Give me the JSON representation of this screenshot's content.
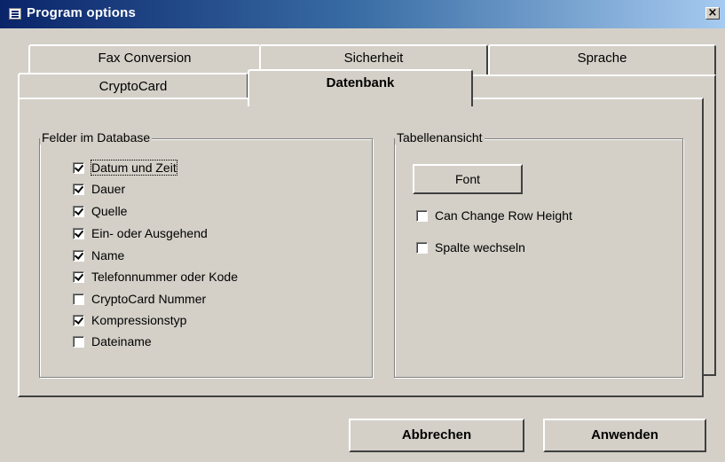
{
  "window": {
    "title": "Program options",
    "close_label": "×",
    "app_icon": "app-icon"
  },
  "tabs": {
    "back_row": [
      {
        "label": "Fax Conversion"
      },
      {
        "label": "Sicherheit"
      },
      {
        "label": "Sprache"
      }
    ],
    "front_row": [
      {
        "label": "CryptoCard"
      },
      {
        "label": "Datenbank"
      }
    ],
    "active": "Datenbank"
  },
  "fields_group": {
    "title": "Felder im Database",
    "items": [
      {
        "label": "Datum und Zeit",
        "checked": true
      },
      {
        "label": "Dauer",
        "checked": true
      },
      {
        "label": "Quelle",
        "checked": true
      },
      {
        "label": "Ein- oder Ausgehend",
        "checked": true
      },
      {
        "label": "Name",
        "checked": true
      },
      {
        "label": "Telefonnummer oder Kode",
        "checked": true
      },
      {
        "label": "CryptoCard Nummer",
        "checked": false
      },
      {
        "label": "Kompressionstyp",
        "checked": true
      },
      {
        "label": "Dateiname",
        "checked": false
      }
    ]
  },
  "table_group": {
    "title": "Tabellenansicht",
    "font_button": "Font",
    "options": [
      {
        "label": "Can Change Row Height",
        "checked": false
      },
      {
        "label": "Spalte wechseln",
        "checked": false
      }
    ]
  },
  "footer": {
    "cancel_label": "Abbrechen",
    "apply_label": "Anwenden"
  }
}
